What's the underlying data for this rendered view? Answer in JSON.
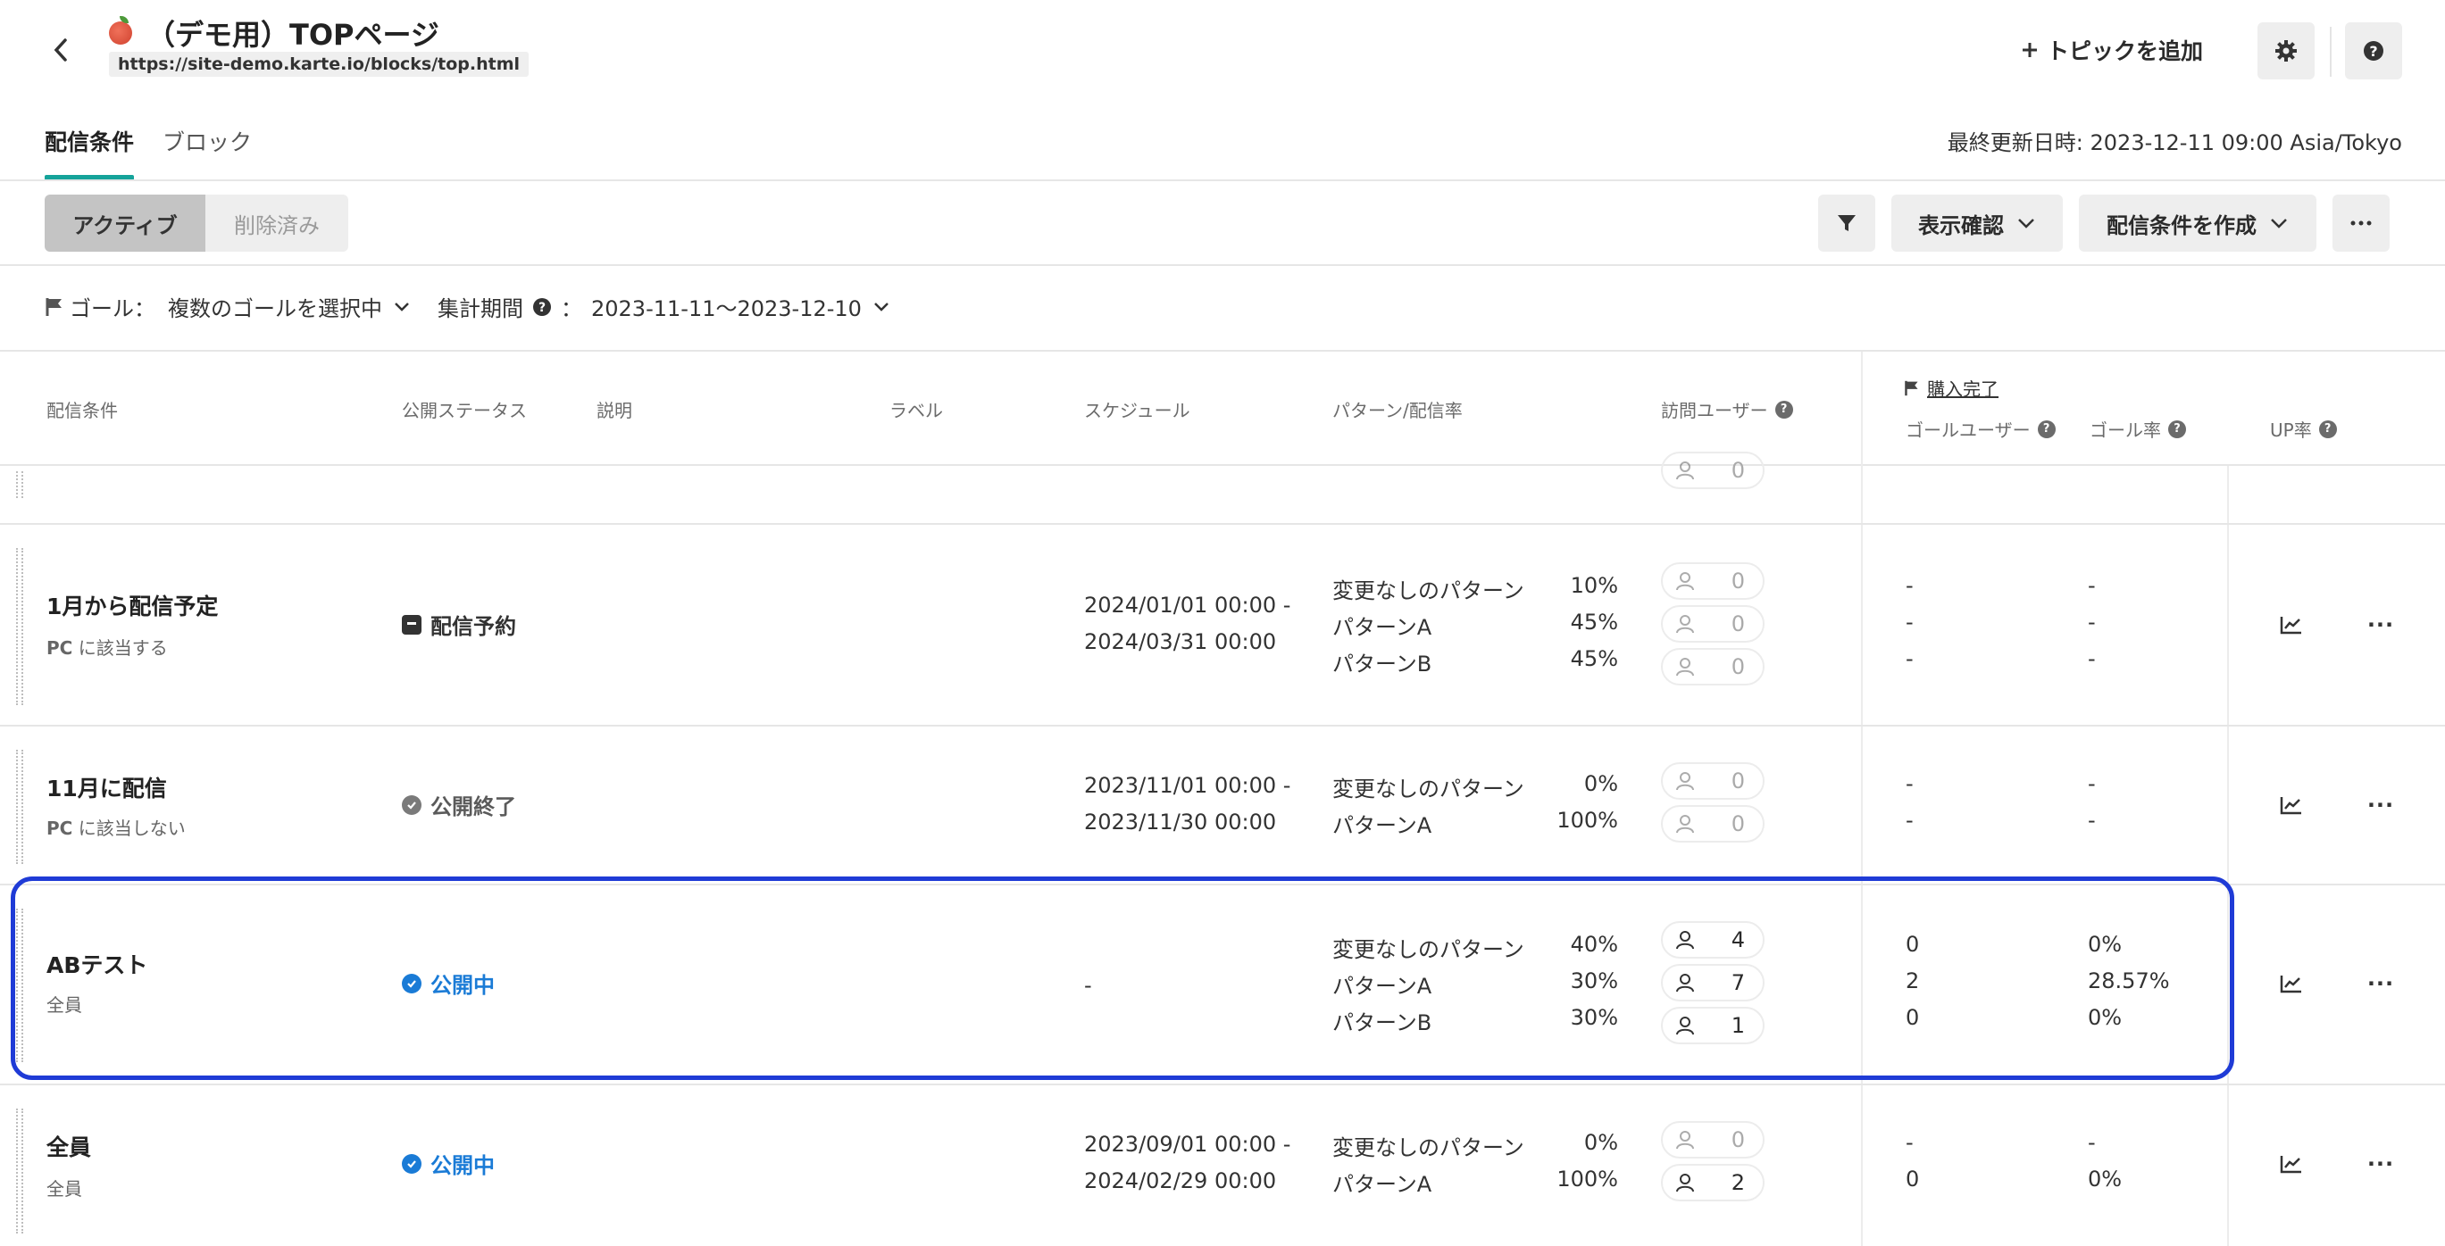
{
  "header": {
    "title": "（デモ用）TOPページ",
    "url": "https://site-demo.karte.io/blocks/top.html",
    "add_topic_label": "トピックを追加"
  },
  "tabs": [
    {
      "label": "配信条件",
      "active": true
    },
    {
      "label": "ブロック",
      "active": false
    }
  ],
  "last_updated": "最終更新日時: 2023-12-11 09:00 Asia/Tokyo",
  "toolbar": {
    "active_label": "アクティブ",
    "deleted_label": "削除済み",
    "preview_label": "表示確認",
    "create_label": "配信条件を作成"
  },
  "goalbar": {
    "goal_label": "ゴール：",
    "goal_value": "複数のゴールを選択中",
    "period_label": "集計期間",
    "period_sep": "：",
    "period_value": "2023-11-11〜2023-12-10"
  },
  "table_headers": {
    "condition": "配信条件",
    "status": "公開ステータス",
    "description": "説明",
    "label": "ラベル",
    "schedule": "スケジュール",
    "pattern": "パターン/配信率",
    "visitors": "訪問ユーザー",
    "goal_name": "購入完了",
    "goal_users": "ゴールユーザー",
    "goal_rate": "ゴール率",
    "up_rate": "UP率"
  },
  "partial_row": {
    "visitor": "0"
  },
  "rows": [
    {
      "name": "1月から配信予定",
      "sub_strong": "PC",
      "sub_rest": "に該当する",
      "status": "配信予約",
      "schedule": [
        "2024/01/01 00:00 -",
        "2024/03/31 00:00"
      ],
      "patterns": [
        {
          "name": "変更なしのパターン",
          "rate": "10%",
          "visitors": "0",
          "goal_users": "-",
          "goal_rate": "-"
        },
        {
          "name": "パターンA",
          "rate": "45%",
          "visitors": "0",
          "goal_users": "-",
          "goal_rate": "-"
        },
        {
          "name": "パターンB",
          "rate": "45%",
          "visitors": "0",
          "goal_users": "-",
          "goal_rate": "-"
        }
      ]
    },
    {
      "name": "11月に配信",
      "sub_strong": "PC",
      "sub_rest": "に該当しない",
      "status": "公開終了",
      "schedule": [
        "2023/11/01 00:00 -",
        "2023/11/30 00:00"
      ],
      "patterns": [
        {
          "name": "変更なしのパターン",
          "rate": "0%",
          "visitors": "0",
          "goal_users": "-",
          "goal_rate": "-"
        },
        {
          "name": "パターンA",
          "rate": "100%",
          "visitors": "0",
          "goal_users": "-",
          "goal_rate": "-"
        }
      ]
    },
    {
      "name": "ABテスト",
      "sub_strong": "",
      "sub_rest": "全員",
      "status": "公開中",
      "schedule": [
        "-"
      ],
      "patterns": [
        {
          "name": "変更なしのパターン",
          "rate": "40%",
          "visitors": "4",
          "goal_users": "0",
          "goal_rate": "0%"
        },
        {
          "name": "パターンA",
          "rate": "30%",
          "visitors": "7",
          "goal_users": "2",
          "goal_rate": "28.57%"
        },
        {
          "name": "パターンB",
          "rate": "30%",
          "visitors": "1",
          "goal_users": "0",
          "goal_rate": "0%"
        }
      ]
    },
    {
      "name": "全員",
      "sub_strong": "",
      "sub_rest": "全員",
      "status": "公開中",
      "schedule": [
        "2023/09/01 00:00 -",
        "2024/02/29 00:00"
      ],
      "patterns": [
        {
          "name": "変更なしのパターン",
          "rate": "0%",
          "visitors": "0",
          "goal_users": "-",
          "goal_rate": "-"
        },
        {
          "name": "パターンA",
          "rate": "100%",
          "visitors": "2",
          "goal_users": "0",
          "goal_rate": "0%"
        }
      ]
    }
  ],
  "colors": {
    "accent": "#15a39a",
    "live": "#1a7bd6",
    "highlight": "#1f3bd6"
  }
}
